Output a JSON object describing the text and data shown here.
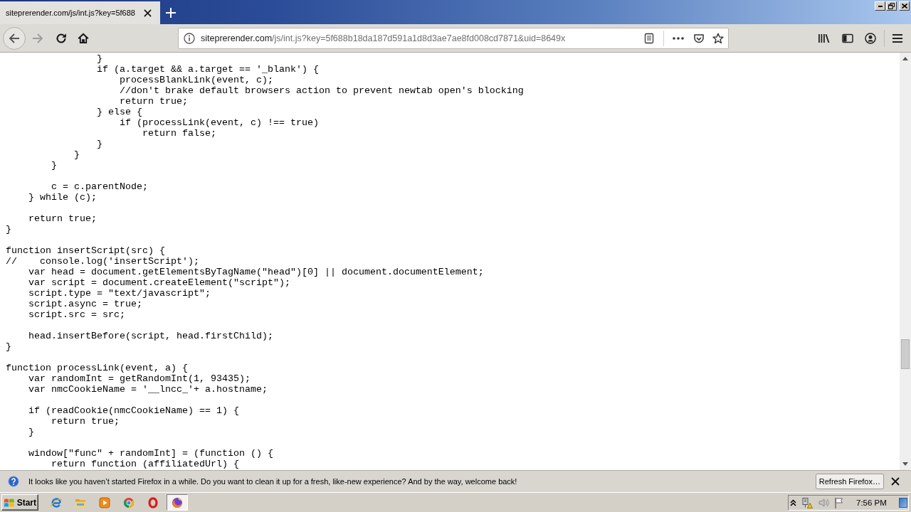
{
  "window": {
    "tabs": [
      {
        "title": "siteprerender.com/js/int.js?key=5f688",
        "selected": true
      }
    ]
  },
  "toolbar": {
    "back": {
      "disabled": false
    },
    "forward": {
      "disabled": true
    },
    "address_bar": {
      "host": "siteprerender.com",
      "path": "/js/int.js?key=5f688b18da187d591a1d8d3ae7ae8fd008cd7871&uid=8649x"
    }
  },
  "code_blocks": [
    [
      "                }",
      "                if (a.target && a.target == '_blank') {",
      "                    processBlankLink(event, c);",
      "                    //don't brake default browsers action to prevent newtab open's blocking",
      "                    return true;",
      "                } else {",
      "                    if (processLink(event, c) !== true)",
      "                        return false;",
      "                }",
      "            }",
      "        }"
    ],
    [
      "        c = c.parentNode;",
      "    } while (c);"
    ],
    [
      "    return true;",
      "}"
    ],
    [
      "function insertScript(src) {",
      "//    console.log('insertScript');",
      "    var head = document.getElementsByTagName(\"head\")[0] || document.documentElement;",
      "    var script = document.createElement(\"script\");",
      "    script.type = \"text/javascript\";",
      "    script.async = true;",
      "    script.src = src;"
    ],
    [
      "    head.insertBefore(script, head.firstChild);",
      "}"
    ],
    [
      "function processLink(event, a) {",
      "    var randomInt = getRandomInt(1, 93435);",
      "    var nmcCookieName = '__lncc_'+ a.hostname;"
    ],
    [
      "    if (readCookie(nmcCookieName) == 1) {",
      "        return true;",
      "    }"
    ],
    [
      "    window[\"func\" + randomInt] = (function () {",
      "        return function (affiliatedUrl) {"
    ]
  ],
  "notification": {
    "message": "It looks like you haven’t started Firefox in a while. Do you want to clean it up for a fresh, like-new experience? And by the way, welcome back!",
    "button": "Refresh Firefox…"
  },
  "taskbar": {
    "start": "Start",
    "apps": [
      {
        "kind": "ie",
        "selected": false
      },
      {
        "kind": "explorer",
        "selected": false
      },
      {
        "kind": "media",
        "selected": false
      },
      {
        "kind": "chrome",
        "selected": false
      },
      {
        "kind": "opera",
        "selected": false
      },
      {
        "kind": "firefox",
        "selected": true
      }
    ],
    "clock": "7:56 PM"
  }
}
